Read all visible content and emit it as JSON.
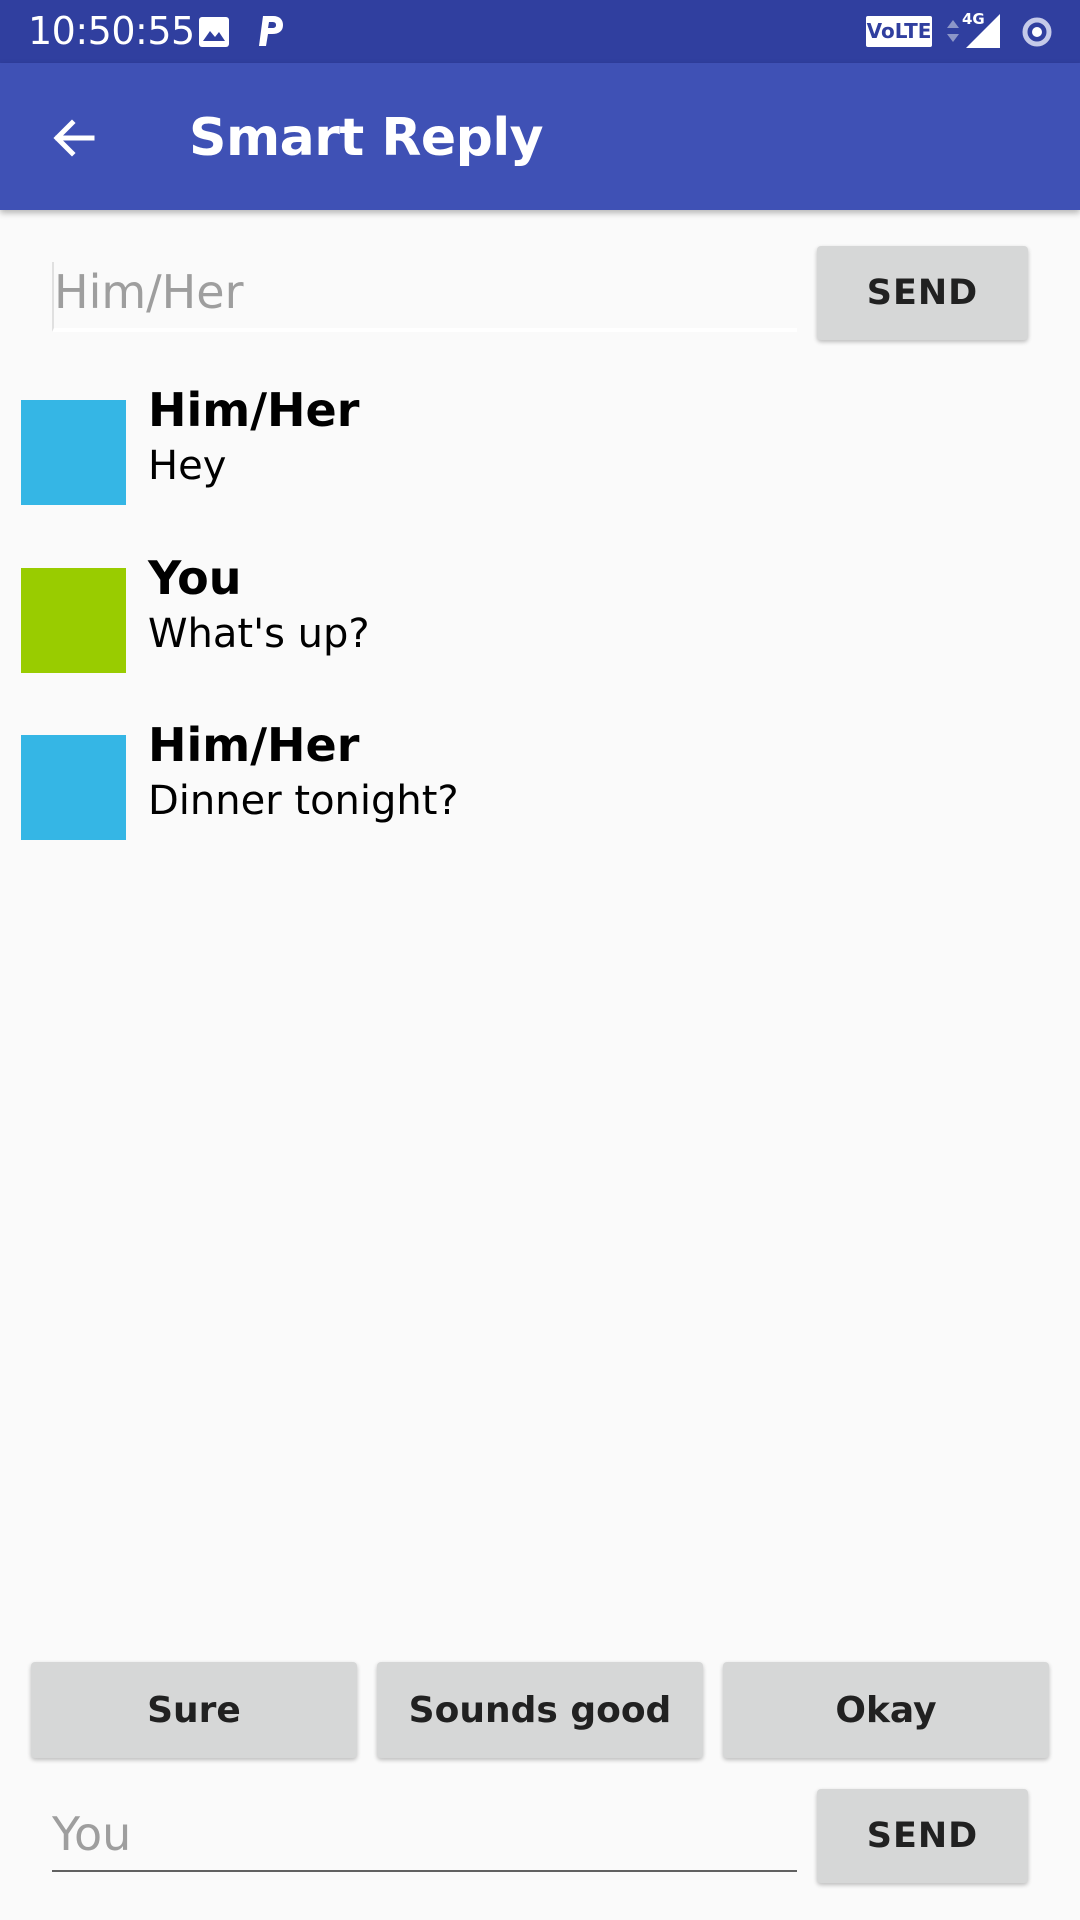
{
  "status_bar": {
    "time": "10:50:55",
    "network_label": "VoLTE",
    "network_type": "4G",
    "icons": [
      "image-icon",
      "parking-icon",
      "volte-icon",
      "data-arrows-icon",
      "signal-icon",
      "sync-icon"
    ]
  },
  "app_bar": {
    "title": "Smart Reply",
    "back_icon": "arrow-back-icon"
  },
  "top_input": {
    "placeholder": "Him/Her",
    "send_label": "SEND"
  },
  "messages": [
    {
      "sender": "Him/Her",
      "text": "Hey",
      "avatar_color": "#35b6e5"
    },
    {
      "sender": "You",
      "text": "What's up?",
      "avatar_color": "#99cc00"
    },
    {
      "sender": "Him/Her",
      "text": "Dinner tonight?",
      "avatar_color": "#35b6e5"
    }
  ],
  "suggestions": [
    "Sure",
    "Sounds good",
    "Okay"
  ],
  "bottom_input": {
    "placeholder": "You",
    "send_label": "SEND"
  },
  "colors": {
    "status_bar": "#303f9f",
    "app_bar": "#3f51b5",
    "background": "#fafafa",
    "button": "#d6d7d7"
  }
}
